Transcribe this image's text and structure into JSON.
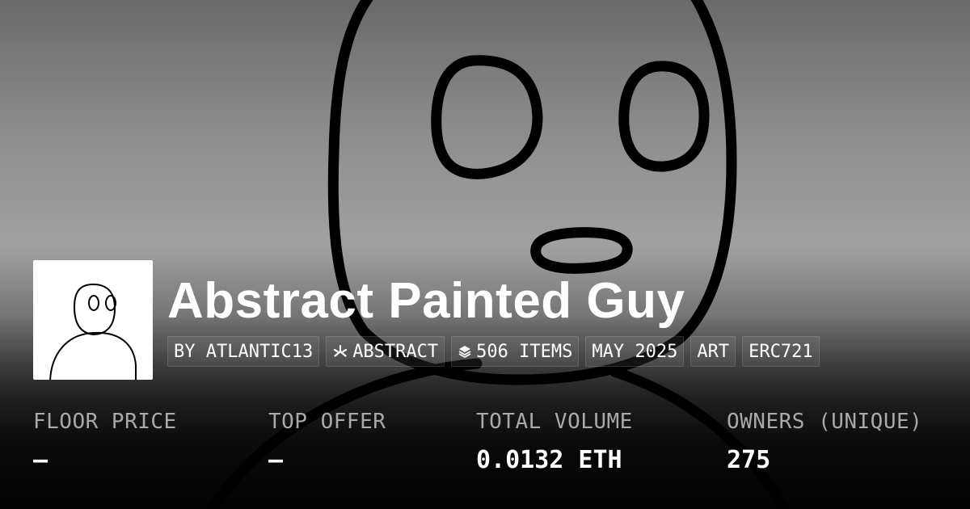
{
  "collection": {
    "name": "Abstract Painted Guy",
    "creator": "BY ATLANTIC13",
    "chain": "ABSTRACT",
    "chain_icon": "abstract-logo-icon",
    "items": "506 ITEMS",
    "items_icon": "layers-icon",
    "date": "MAY 2025",
    "category": "ART",
    "standard": "ERC721"
  },
  "stats": [
    {
      "label": "FLOOR PRICE",
      "value": "—"
    },
    {
      "label": "TOP OFFER",
      "value": "—"
    },
    {
      "label": "TOTAL VOLUME",
      "value": "0.0132 ETH"
    },
    {
      "label": "OWNERS (UNIQUE)",
      "value": "275"
    }
  ],
  "colors": {
    "text": "#ffffff",
    "muted_label": "#a9a9a9",
    "thumbnail_bg": "#ffffff",
    "line_art": "#000000"
  }
}
